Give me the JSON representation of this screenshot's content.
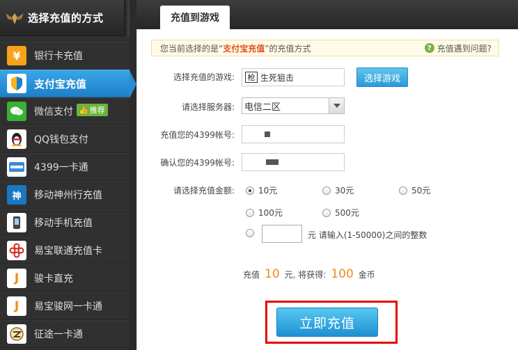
{
  "sidebar": {
    "title": "选择充值的方式",
    "items": [
      {
        "label": "银行卡充值",
        "icon": "¥",
        "icon_color": "#f7a21b"
      },
      {
        "label": "支付宝充值",
        "icon": "shield",
        "icon_color": "#1d7fc8",
        "active": true
      },
      {
        "label": "微信支付",
        "icon": "wechat",
        "icon_color": "#3cb035",
        "badge": "推荐"
      },
      {
        "label": "QQ钱包支付",
        "icon": "qq",
        "icon_color": "#222222"
      },
      {
        "label": "4399一卡通",
        "icon": "4399",
        "icon_color": "#3a8ad6"
      },
      {
        "label": "移动神州行充值",
        "icon": "神",
        "icon_color": "#1a78c2"
      },
      {
        "label": "移动手机充值",
        "icon": "phone",
        "icon_color": "#333333"
      },
      {
        "label": "易宝联通充值卡",
        "icon": "unicom",
        "icon_color": "#d9231c"
      },
      {
        "label": "骏卡直充",
        "icon": "J",
        "icon_color": "#f08b19"
      },
      {
        "label": "易宝骏网一卡通",
        "icon": "J",
        "icon_color": "#f08b19"
      },
      {
        "label": "征途一卡通",
        "icon": "zt",
        "icon_color": "#555555"
      }
    ]
  },
  "main": {
    "tab": "充值到游戏",
    "notice": {
      "prefix": "您当前选择的是“",
      "method": "支付宝充值",
      "suffix": "”的充值方式",
      "help": "充值遇到问题?"
    },
    "form": {
      "game_label": "选择充值的游戏:",
      "game_chip": "枪",
      "game_value": "生死狙击",
      "choose_game_button": "选择游戏",
      "server_label": "请选择服务器:",
      "server_value": "电信二区",
      "account_label": "充值您的4399帐号:",
      "confirm_label": "确认您的4399帐号:",
      "amount_label": "请选择充值金额:",
      "amounts": [
        "10元",
        "30元",
        "50元",
        "100元",
        "500元"
      ],
      "selected_amount": "10元",
      "custom_unit": "元",
      "custom_hint": "请输入(1-50000)之间的整数"
    },
    "summary": {
      "prefix": "充值",
      "amount": "10",
      "middle": "元, 将获得:",
      "coins": "100",
      "suffix": "金币"
    },
    "submit_button": "立即充值"
  }
}
